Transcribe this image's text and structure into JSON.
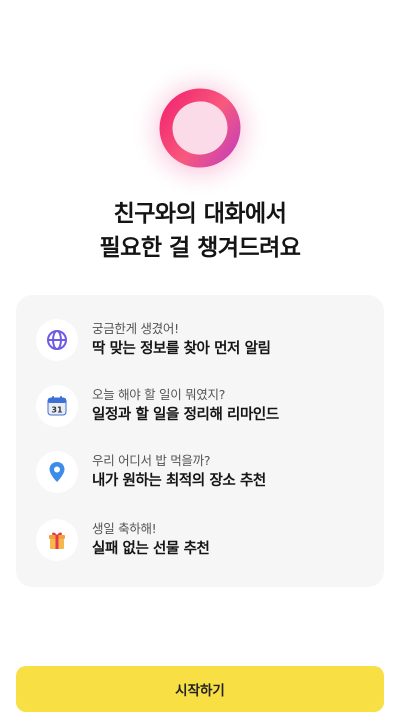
{
  "hero": {
    "logo_icon": "ring-logo-icon",
    "title_line1": "친구와의 대화에서",
    "title_line2": "필요한 걸 챙겨드려요"
  },
  "features": [
    {
      "icon": "globe-icon",
      "sub": "궁금한게 생겼어!",
      "main": "딱 맞는 정보를 찾아 먼저 알림"
    },
    {
      "icon": "calendar-icon",
      "icon_text": "31",
      "sub": "오늘 해야 할 일이 뭐였지?",
      "main": "일정과 할 일을 정리해 리마인드"
    },
    {
      "icon": "location-pin-icon",
      "sub": "우리 어디서 밥 먹을까?",
      "main": "내가 원하는 최적의 장소 추천"
    },
    {
      "icon": "gift-icon",
      "sub": "생일 축하해!",
      "main": "실패 없는 선물 추천"
    }
  ],
  "start_button": {
    "label": "시작하기"
  },
  "colors": {
    "button": "#f8e044",
    "card": "#f6f6f6",
    "logo_gradient": [
      "#f2256f",
      "#f8597d",
      "#c640b8"
    ]
  }
}
